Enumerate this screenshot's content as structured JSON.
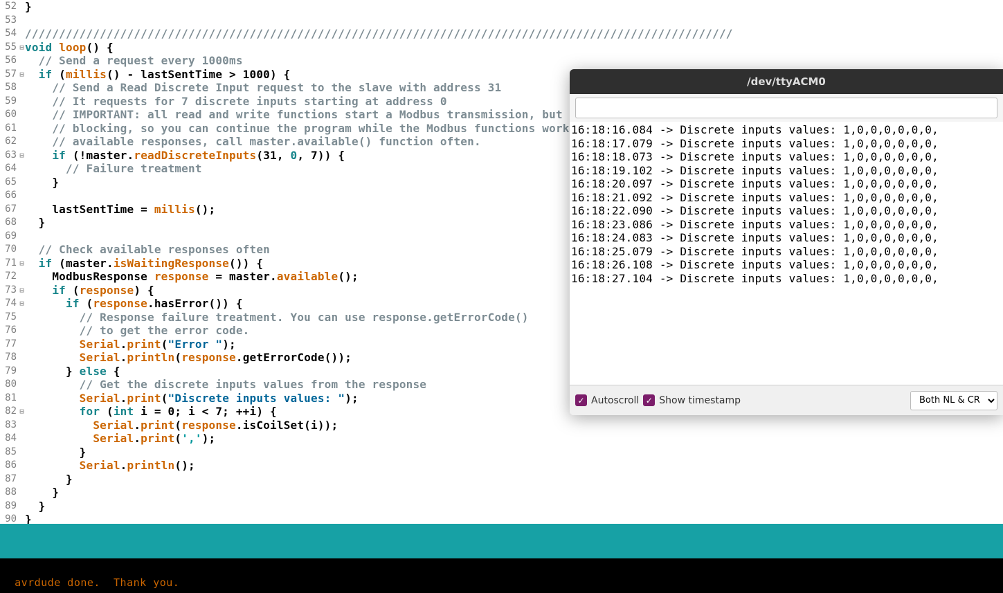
{
  "editor": {
    "lines": [
      {
        "num": 52,
        "fold": "",
        "tokens": [
          [
            "plain",
            "}"
          ]
        ]
      },
      {
        "num": 53,
        "fold": "",
        "tokens": []
      },
      {
        "num": 54,
        "fold": "",
        "tokens": [
          [
            "cmt",
            "////////////////////////////////////////////////////////////////////////////////////////////////////////"
          ]
        ]
      },
      {
        "num": 55,
        "fold": "⊟",
        "tokens": [
          [
            "kw",
            "void"
          ],
          [
            "plain",
            " "
          ],
          [
            "fn",
            "loop"
          ],
          [
            "plain",
            "() {"
          ]
        ]
      },
      {
        "num": 56,
        "fold": "",
        "tokens": [
          [
            "plain",
            "  "
          ],
          [
            "cmt",
            "// Send a request every 1000ms"
          ]
        ]
      },
      {
        "num": 57,
        "fold": "⊟",
        "tokens": [
          [
            "plain",
            "  "
          ],
          [
            "kw",
            "if"
          ],
          [
            "plain",
            " ("
          ],
          [
            "fn",
            "millis"
          ],
          [
            "plain",
            "() - lastSentTime > 1000) {"
          ]
        ]
      },
      {
        "num": 58,
        "fold": "",
        "tokens": [
          [
            "plain",
            "    "
          ],
          [
            "cmt",
            "// Send a Read Discrete Input request to the slave with address 31"
          ]
        ]
      },
      {
        "num": 59,
        "fold": "",
        "tokens": [
          [
            "plain",
            "    "
          ],
          [
            "cmt",
            "// It requests for 7 discrete inputs starting at address 0"
          ]
        ]
      },
      {
        "num": 60,
        "fold": "",
        "tokens": [
          [
            "plain",
            "    "
          ],
          [
            "cmt",
            "// IMPORTANT: all read and write functions start a Modbus transmission, but "
          ]
        ]
      },
      {
        "num": 61,
        "fold": "",
        "tokens": [
          [
            "plain",
            "    "
          ],
          [
            "cmt",
            "// blocking, so you can continue the program while the Modbus functions work"
          ]
        ]
      },
      {
        "num": 62,
        "fold": "",
        "tokens": [
          [
            "plain",
            "    "
          ],
          [
            "cmt",
            "// available responses, call master.available() function often."
          ]
        ]
      },
      {
        "num": 63,
        "fold": "⊟",
        "tokens": [
          [
            "plain",
            "    "
          ],
          [
            "kw",
            "if"
          ],
          [
            "plain",
            " (!"
          ],
          [
            "plain",
            "master"
          ],
          [
            "plain",
            "."
          ],
          [
            "fn",
            "readDiscreteInputs"
          ],
          [
            "plain",
            "(31, "
          ],
          [
            "kw",
            "0"
          ],
          [
            "plain",
            ", 7)) {"
          ]
        ]
      },
      {
        "num": 64,
        "fold": "",
        "tokens": [
          [
            "plain",
            "      "
          ],
          [
            "cmt",
            "// Failure treatment"
          ]
        ]
      },
      {
        "num": 65,
        "fold": "",
        "tokens": [
          [
            "plain",
            "    }"
          ]
        ]
      },
      {
        "num": 66,
        "fold": "",
        "tokens": []
      },
      {
        "num": 67,
        "fold": "",
        "tokens": [
          [
            "plain",
            "    lastSentTime = "
          ],
          [
            "fn",
            "millis"
          ],
          [
            "plain",
            "();"
          ]
        ]
      },
      {
        "num": 68,
        "fold": "",
        "tokens": [
          [
            "plain",
            "  }"
          ]
        ]
      },
      {
        "num": 69,
        "fold": "",
        "tokens": []
      },
      {
        "num": 70,
        "fold": "",
        "tokens": [
          [
            "plain",
            "  "
          ],
          [
            "cmt",
            "// Check available responses often"
          ]
        ]
      },
      {
        "num": 71,
        "fold": "⊟",
        "tokens": [
          [
            "plain",
            "  "
          ],
          [
            "kw",
            "if"
          ],
          [
            "plain",
            " (master."
          ],
          [
            "fn",
            "isWaitingResponse"
          ],
          [
            "plain",
            "()) {"
          ]
        ]
      },
      {
        "num": 72,
        "fold": "",
        "tokens": [
          [
            "plain",
            "    ModbusResponse "
          ],
          [
            "fn",
            "response"
          ],
          [
            "plain",
            " = master."
          ],
          [
            "fn",
            "available"
          ],
          [
            "plain",
            "();"
          ]
        ]
      },
      {
        "num": 73,
        "fold": "⊟",
        "tokens": [
          [
            "plain",
            "    "
          ],
          [
            "kw",
            "if"
          ],
          [
            "plain",
            " ("
          ],
          [
            "fn",
            "response"
          ],
          [
            "plain",
            ") {"
          ]
        ]
      },
      {
        "num": 74,
        "fold": "⊟",
        "tokens": [
          [
            "plain",
            "      "
          ],
          [
            "kw",
            "if"
          ],
          [
            "plain",
            " ("
          ],
          [
            "fn",
            "response"
          ],
          [
            "plain",
            ".hasError()) {"
          ]
        ]
      },
      {
        "num": 75,
        "fold": "",
        "tokens": [
          [
            "plain",
            "        "
          ],
          [
            "cmt",
            "// Response failure treatment. You can use response.getErrorCode()"
          ]
        ]
      },
      {
        "num": 76,
        "fold": "",
        "tokens": [
          [
            "plain",
            "        "
          ],
          [
            "cmt",
            "// to get the error code."
          ]
        ]
      },
      {
        "num": 77,
        "fold": "",
        "tokens": [
          [
            "plain",
            "        "
          ],
          [
            "fn",
            "Serial"
          ],
          [
            "plain",
            "."
          ],
          [
            "fn",
            "print"
          ],
          [
            "plain",
            "("
          ],
          [
            "str",
            "\"Error \""
          ],
          [
            "plain",
            ");"
          ]
        ]
      },
      {
        "num": 78,
        "fold": "",
        "tokens": [
          [
            "plain",
            "        "
          ],
          [
            "fn",
            "Serial"
          ],
          [
            "plain",
            "."
          ],
          [
            "fn",
            "println"
          ],
          [
            "plain",
            "("
          ],
          [
            "fn",
            "response"
          ],
          [
            "plain",
            ".getErrorCode());"
          ]
        ]
      },
      {
        "num": 79,
        "fold": "",
        "tokens": [
          [
            "plain",
            "      } "
          ],
          [
            "kw",
            "else"
          ],
          [
            "plain",
            " {"
          ]
        ]
      },
      {
        "num": 80,
        "fold": "",
        "tokens": [
          [
            "plain",
            "        "
          ],
          [
            "cmt",
            "// Get the discrete inputs values from the response"
          ]
        ]
      },
      {
        "num": 81,
        "fold": "",
        "tokens": [
          [
            "plain",
            "        "
          ],
          [
            "fn",
            "Serial"
          ],
          [
            "plain",
            "."
          ],
          [
            "fn",
            "print"
          ],
          [
            "plain",
            "("
          ],
          [
            "str",
            "\"Discrete inputs values: \""
          ],
          [
            "plain",
            ");"
          ]
        ]
      },
      {
        "num": 82,
        "fold": "⊟",
        "tokens": [
          [
            "plain",
            "        "
          ],
          [
            "kw",
            "for"
          ],
          [
            "plain",
            " ("
          ],
          [
            "kw",
            "int"
          ],
          [
            "plain",
            " i = 0; i < 7; ++i) {"
          ]
        ]
      },
      {
        "num": 83,
        "fold": "",
        "tokens": [
          [
            "plain",
            "          "
          ],
          [
            "fn",
            "Serial"
          ],
          [
            "plain",
            "."
          ],
          [
            "fn",
            "print"
          ],
          [
            "plain",
            "("
          ],
          [
            "fn",
            "response"
          ],
          [
            "plain",
            ".isCoilSet(i));"
          ]
        ]
      },
      {
        "num": 84,
        "fold": "",
        "tokens": [
          [
            "plain",
            "          "
          ],
          [
            "fn",
            "Serial"
          ],
          [
            "plain",
            "."
          ],
          [
            "fn",
            "print"
          ],
          [
            "plain",
            "("
          ],
          [
            "chr",
            "','"
          ],
          [
            "plain",
            ");"
          ]
        ]
      },
      {
        "num": 85,
        "fold": "",
        "tokens": [
          [
            "plain",
            "        }"
          ]
        ]
      },
      {
        "num": 86,
        "fold": "",
        "tokens": [
          [
            "plain",
            "        "
          ],
          [
            "fn",
            "Serial"
          ],
          [
            "plain",
            "."
          ],
          [
            "fn",
            "println"
          ],
          [
            "plain",
            "();"
          ]
        ]
      },
      {
        "num": 87,
        "fold": "",
        "tokens": [
          [
            "plain",
            "      }"
          ]
        ]
      },
      {
        "num": 88,
        "fold": "",
        "tokens": [
          [
            "plain",
            "    }"
          ]
        ]
      },
      {
        "num": 89,
        "fold": "",
        "tokens": [
          [
            "plain",
            "  }"
          ]
        ]
      },
      {
        "num": 90,
        "fold": "",
        "tokens": [
          [
            "plain",
            "}"
          ]
        ]
      }
    ]
  },
  "console": {
    "text": "avrdude done.  Thank you."
  },
  "serial": {
    "title": "/dev/ttyACM0",
    "input_value": "",
    "output_lines": [
      "16:18:16.084 -> Discrete inputs values: 1,0,0,0,0,0,0,",
      "16:18:17.079 -> Discrete inputs values: 1,0,0,0,0,0,0,",
      "16:18:18.073 -> Discrete inputs values: 1,0,0,0,0,0,0,",
      "16:18:19.102 -> Discrete inputs values: 1,0,0,0,0,0,0,",
      "16:18:20.097 -> Discrete inputs values: 1,0,0,0,0,0,0,",
      "16:18:21.092 -> Discrete inputs values: 1,0,0,0,0,0,0,",
      "16:18:22.090 -> Discrete inputs values: 1,0,0,0,0,0,0,",
      "16:18:23.086 -> Discrete inputs values: 1,0,0,0,0,0,0,",
      "16:18:24.083 -> Discrete inputs values: 1,0,0,0,0,0,0,",
      "16:18:25.079 -> Discrete inputs values: 1,0,0,0,0,0,0,",
      "16:18:26.108 -> Discrete inputs values: 1,0,0,0,0,0,0,",
      "16:18:27.104 -> Discrete inputs values: 1,0,0,0,0,0,0,"
    ],
    "autoscroll_label": "Autoscroll",
    "timestamp_label": "Show timestamp",
    "line_ending_selected": "Both NL & CR"
  }
}
